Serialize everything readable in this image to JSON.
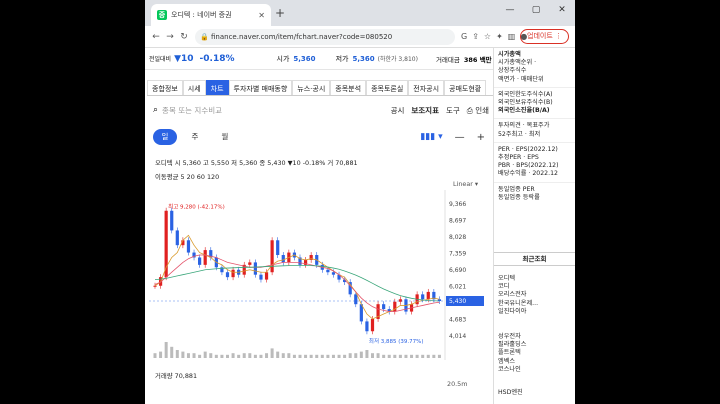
{
  "browser": {
    "tab_title": "오디텍 : 네이버 증권",
    "favicon": "증",
    "new_tab": "+",
    "url": "finance.naver.com/item/fchart.naver?code=080520",
    "update_button": "업데이트",
    "controls": [
      "—",
      "▢",
      "✕"
    ]
  },
  "summary": {
    "low_label": "전일대비",
    "change": "▼10",
    "change_pct": "-0.18%",
    "open_label": "시가",
    "open": "5,360",
    "low2_label": "저가",
    "low2": "5,360",
    "limit_down": "(하한가 3,810)",
    "volume_amt_label": "거래대금",
    "volume_amt": "386 백만"
  },
  "menu": [
    "종합정보",
    "시세",
    "차트",
    "투자자별 매매동향",
    "뉴스·공시",
    "종목분석",
    "종목토론실",
    "전자공시",
    "공매도현황"
  ],
  "menu_active": 2,
  "search": {
    "placeholder": "종목 또는 지수비교",
    "tools": [
      "공시",
      "보조지표",
      "도구",
      "인쇄"
    ]
  },
  "periods": [
    "일",
    "주",
    "월"
  ],
  "period_active": 0,
  "zoom_out": "—",
  "zoom_in": "+",
  "quote": {
    "name": "오디텍",
    "text": "시 5,360 고 5,550 저 5,360 종 5,430 ▼10 -0.18% 거 70,881"
  },
  "ma_line": "이동평균 5 20 60 120",
  "scale_label": "Linear",
  "volume_label": "거래량 70,881",
  "volume_axis_label": "20.5m",
  "right_panel": {
    "sec1": [
      "시가총액",
      "시가총액순위 ·",
      "상장주식수",
      "액면가 · 매매단위"
    ],
    "sec2": [
      "외국인한도주식수(A)",
      "외국인보유주식수(B)",
      "외국인소진율(B/A)"
    ],
    "sec3": [
      "투자의견 · 목표주가",
      "52주최고 · 최저"
    ],
    "sec4": [
      "PER · EPS(2022.12)",
      "추정PER · EPS",
      "PBR · BPS(2022.12)",
      "배당수익률 · 2022.12"
    ],
    "sec5": [
      "동일업종 PER",
      "동일업종 등락률"
    ],
    "recent_title": "최근조회",
    "recent": [
      "오디텍",
      "코디",
      "오리스전자",
      "한국유니온제...",
      "일진다이아"
    ],
    "recent2": [
      "성우전자",
      "필라훌딩스",
      "플트론텍",
      "엠벡스",
      "코스나인"
    ],
    "bottom": "HSD엔진"
  },
  "chart_data": {
    "type": "candlestick",
    "y_ticks": [
      "9,366",
      "8,697",
      "8,028",
      "7,359",
      "6,690",
      "6,021",
      "5,430",
      "4,683",
      "4,014"
    ],
    "ylim": [
      3600,
      9700
    ],
    "current_price": "5,430",
    "high_annotation": "최고 9,280 (-42.17%)",
    "low_annotation": "최저 3,885 (39.77%)",
    "closes": [
      6050,
      6400,
      9100,
      8300,
      7700,
      7900,
      7400,
      7200,
      6900,
      7500,
      7200,
      6800,
      6600,
      6400,
      6700,
      6500,
      6900,
      7000,
      6500,
      6300,
      6600,
      7900,
      7300,
      7000,
      7400,
      7200,
      6900,
      7100,
      7300,
      6900,
      6700,
      6600,
      6500,
      6300,
      6200,
      5700,
      5300,
      4600,
      4200,
      4700,
      5300,
      5100,
      5000,
      5400,
      5500,
      5000,
      5300,
      5700,
      5500,
      5800,
      5500,
      5430
    ],
    "ma5": [
      6050,
      6200,
      6800,
      7200,
      7400,
      7900,
      8100,
      7700,
      7400,
      7300,
      7200,
      7000,
      6900,
      6700,
      6600,
      6600,
      6650,
      6700,
      6650,
      6600,
      6600,
      6900,
      7050,
      7100,
      7200,
      7300,
      7150,
      7100,
      7150,
      7100,
      6950,
      6800,
      6650,
      6500,
      6400,
      6100,
      5800,
      5300,
      4900,
      4700,
      4800,
      4900,
      5000,
      5100,
      5250,
      5250,
      5300,
      5400,
      5450,
      5500,
      5550,
      5500
    ],
    "ma20": [
      6100,
      6200,
      6400,
      6600,
      6800,
      7000,
      7150,
      7250,
      7300,
      7300,
      7250,
      7200,
      7100,
      7000,
      6950,
      6900,
      6850,
      6800,
      6800,
      6800,
      6850,
      6900,
      6950,
      7000,
      7000,
      7000,
      6980,
      6950,
      6900,
      6850,
      6800,
      6750,
      6650,
      6500,
      6300,
      6050,
      5800,
      5550,
      5350,
      5200,
      5100,
      5050,
      5000,
      5000,
      5050,
      5100,
      5150,
      5200,
      5250,
      5300,
      5350,
      5380
    ],
    "ma60": [
      6300,
      6320,
      6350,
      6400,
      6450,
      6500,
      6550,
      6600,
      6650,
      6700,
      6720,
      6740,
      6760,
      6770,
      6780,
      6790,
      6800,
      6800,
      6810,
      6820,
      6830,
      6840,
      6850,
      6860,
      6870,
      6880,
      6880,
      6880,
      6870,
      6860,
      6840,
      6810,
      6770,
      6720,
      6650,
      6570,
      6480,
      6380,
      6270,
      6150,
      6030,
      5920,
      5820,
      5730,
      5650,
      5590,
      5540,
      5500,
      5470,
      5450,
      5440,
      5430
    ],
    "volumes": [
      0.3,
      0.4,
      1.0,
      0.7,
      0.5,
      0.4,
      0.3,
      0.3,
      0.2,
      0.4,
      0.3,
      0.2,
      0.2,
      0.2,
      0.3,
      0.2,
      0.3,
      0.3,
      0.2,
      0.2,
      0.3,
      0.6,
      0.4,
      0.3,
      0.3,
      0.2,
      0.2,
      0.2,
      0.2,
      0.2,
      0.2,
      0.2,
      0.2,
      0.2,
      0.2,
      0.3,
      0.3,
      0.4,
      0.5,
      0.3,
      0.3,
      0.2,
      0.2,
      0.2,
      0.2,
      0.2,
      0.2,
      0.2,
      0.2,
      0.2,
      0.2,
      0.2
    ],
    "colors": {
      "up": "#e02020",
      "down": "#2a62e3",
      "ma5": "#d99a2b",
      "ma20": "#e4546b",
      "ma60": "#3aa67a",
      "current_tag": "#2a62e3"
    }
  }
}
